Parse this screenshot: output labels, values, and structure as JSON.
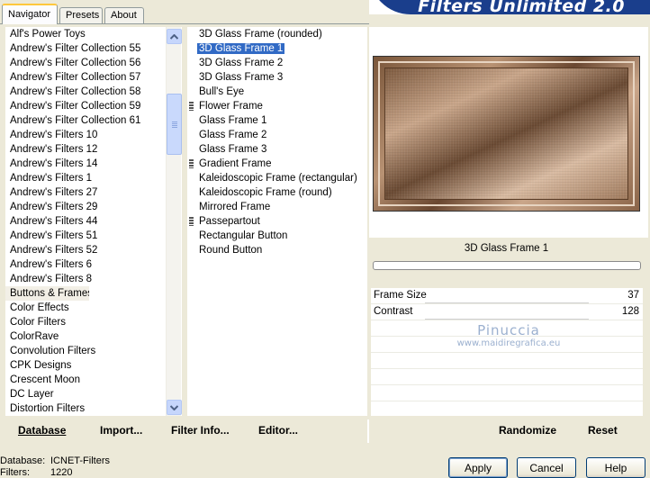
{
  "tabs": [
    "Navigator",
    "Presets",
    "About"
  ],
  "banner": "Filters Unlimited 2.0",
  "categories": [
    "Alf's Power Toys",
    "Andrew's Filter Collection 55",
    "Andrew's Filter Collection 56",
    "Andrew's Filter Collection 57",
    "Andrew's Filter Collection 58",
    "Andrew's Filter Collection 59",
    "Andrew's Filter Collection 61",
    "Andrew's Filters 10",
    "Andrew's Filters 12",
    "Andrew's Filters 14",
    "Andrew's Filters 1",
    "Andrew's Filters 27",
    "Andrew's Filters 29",
    "Andrew's Filters 44",
    "Andrew's Filters 51",
    "Andrew's Filters 52",
    "Andrew's Filters 6",
    "Andrew's Filters 8",
    "Buttons & Frames",
    "Color Effects",
    "Color Filters",
    "ColorRave",
    "Convolution Filters",
    "CPK Designs",
    "Crescent Moon",
    "DC Layer",
    "Distortion Filters"
  ],
  "selected_category": "Buttons & Frames",
  "filters": [
    {
      "label": "3D Glass Frame (rounded)",
      "grip": false
    },
    {
      "label": "3D Glass Frame 1",
      "grip": false
    },
    {
      "label": "3D Glass Frame 2",
      "grip": false
    },
    {
      "label": "3D Glass Frame 3",
      "grip": false
    },
    {
      "label": "Bull's Eye",
      "grip": false
    },
    {
      "label": "Flower Frame",
      "grip": true
    },
    {
      "label": "Glass Frame 1",
      "grip": false
    },
    {
      "label": "Glass Frame 2",
      "grip": false
    },
    {
      "label": "Glass Frame 3",
      "grip": false
    },
    {
      "label": "Gradient Frame",
      "grip": true
    },
    {
      "label": "Kaleidoscopic Frame (rectangular)",
      "grip": false
    },
    {
      "label": "Kaleidoscopic Frame (round)",
      "grip": false
    },
    {
      "label": "Mirrored Frame",
      "grip": false
    },
    {
      "label": "Passepartout",
      "grip": true
    },
    {
      "label": "Rectangular Button",
      "grip": false
    },
    {
      "label": "Round Button",
      "grip": false
    }
  ],
  "selected_filter": "3D Glass Frame 1",
  "preview": {
    "filter_name": "3D Glass Frame 1"
  },
  "params": [
    {
      "label": "Frame Size",
      "value": "37"
    },
    {
      "label": "Contrast",
      "value": "128"
    }
  ],
  "watermark": {
    "name": "Pinuccia",
    "url": "www.maidiregrafica.eu"
  },
  "bottom_buttons": {
    "database": "Database",
    "import": "Import...",
    "filter_info": "Filter Info...",
    "editor": "Editor...",
    "randomize": "Randomize",
    "reset": "Reset"
  },
  "status": {
    "database_label": "Database:",
    "database_value": "ICNET-Filters",
    "filters_label": "Filters:",
    "filters_value": "1220"
  },
  "dialog_buttons": {
    "apply": "Apply",
    "cancel": "Cancel",
    "help": "Help"
  },
  "icons": {
    "scroll_up": "chevron-up-icon",
    "scroll_down": "chevron-down-icon"
  },
  "colors": {
    "selection": "#316ac5",
    "banner_blue": "#1a3e8c",
    "window_bg": "#ece9d8"
  }
}
